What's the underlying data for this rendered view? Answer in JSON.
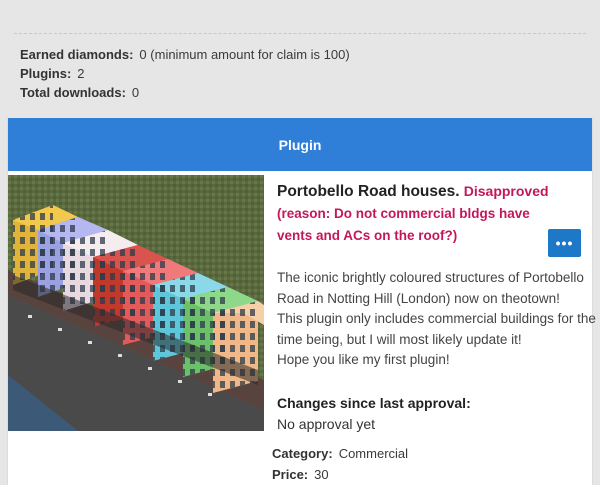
{
  "stats": {
    "earned_label": "Earned diamonds:",
    "earned_value": "0",
    "earned_note": "(minimum amount for claim is 100)",
    "plugins_label": "Plugins:",
    "plugins_value": "2",
    "downloads_label": "Total downloads:",
    "downloads_value": "0"
  },
  "panel": {
    "header": "Plugin"
  },
  "plugin": {
    "title": "Portobello Road houses.",
    "status": "Disapproved",
    "reason": "(reason: Do not commercial bldgs have vents and ACs on the roof?)",
    "menu_icon_label": "•••",
    "description_lines": [
      "The iconic brightly coloured structures of Portobello Road in Notting Hill (London) now on theotown!",
      "This plugin only includes commercial buildings for the time being, but I will most likely update it!",
      "Hope you like my first plugin!"
    ],
    "changes_label": "Changes since last approval:",
    "changes_value": "No approval yet",
    "category_label": "Category:",
    "category_value": "Commercial",
    "price_label": "Price:",
    "price_value": "30"
  },
  "colors": {
    "header_blue": "#2f7ed8",
    "status_red": "#c2185b",
    "button_blue": "#1e78c8"
  }
}
